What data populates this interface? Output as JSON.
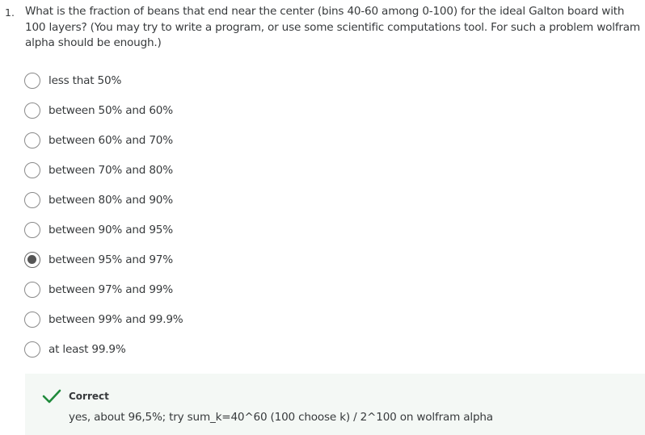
{
  "question": {
    "number": "1.",
    "text": "What is the fraction of beans that end near the center (bins 40-60 among 0-100) for the ideal Galton board with 100 layers? (You may try to write a program, or use some scientific computations tool. For such a problem wolfram alpha should be enough.)"
  },
  "options": [
    {
      "label": "less that 50%",
      "selected": false
    },
    {
      "label": "between 50% and 60%",
      "selected": false
    },
    {
      "label": "between 60% and 70%",
      "selected": false
    },
    {
      "label": "between 70% and 80%",
      "selected": false
    },
    {
      "label": "between 80% and 90%",
      "selected": false
    },
    {
      "label": "between 90% and 95%",
      "selected": false
    },
    {
      "label": "between 95% and 97%",
      "selected": true
    },
    {
      "label": "between 97% and 99%",
      "selected": false
    },
    {
      "label": "between 99% and 99.9%",
      "selected": false
    },
    {
      "label": "at least 99.9%",
      "selected": false
    }
  ],
  "feedback": {
    "status": "Correct",
    "icon": "check-icon",
    "icon_color": "#1f8a3b",
    "text": "yes, about 96,5%; try sum_k=40^60 (100 choose k) / 2^100 on wolfram alpha",
    "background": "#f4f8f5"
  }
}
